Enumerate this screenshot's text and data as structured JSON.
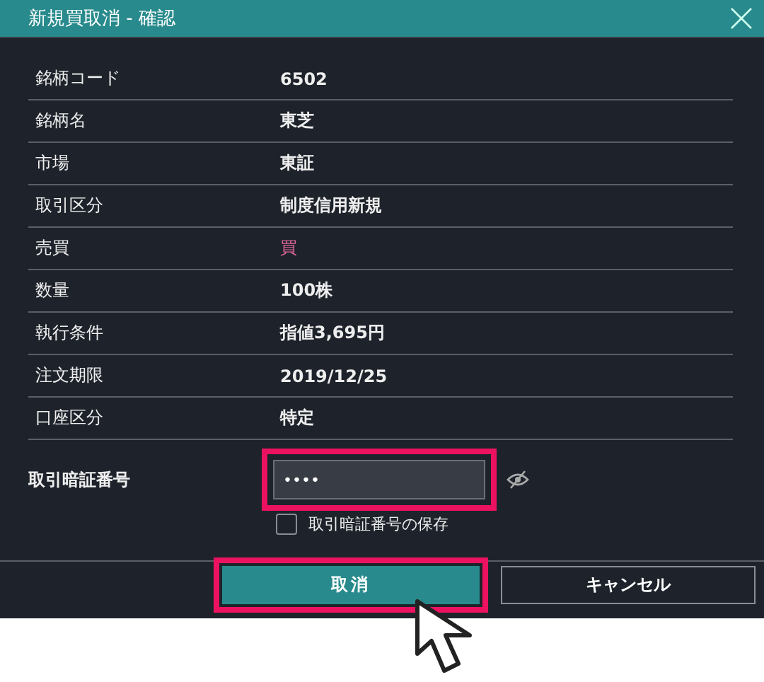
{
  "window": {
    "title": "新規買取消 - 確認"
  },
  "rows": [
    {
      "label": "銘柄コード",
      "value": "6502",
      "kind": "plain"
    },
    {
      "label": "銘柄名",
      "value": "東芝",
      "kind": "plain"
    },
    {
      "label": "市場",
      "value": "東証",
      "kind": "plain"
    },
    {
      "label": "取引区分",
      "value": "制度信用新規",
      "kind": "plain"
    },
    {
      "label": "売買",
      "value": "買",
      "kind": "buy"
    },
    {
      "label": "数量",
      "value": "100株",
      "kind": "plain"
    },
    {
      "label": "執行条件",
      "value": "指値3,695円",
      "kind": "plain"
    },
    {
      "label": "注文期限",
      "value": "2019/12/25",
      "kind": "plain"
    },
    {
      "label": "口座区分",
      "value": "特定",
      "kind": "plain"
    }
  ],
  "pin": {
    "label": "取引暗証番号",
    "value": "••••",
    "highlighted": true,
    "save_label": "取引暗証番号の保存",
    "save_checked": false
  },
  "buttons": [
    {
      "label": "取消",
      "kind": "primary",
      "highlighted": true
    },
    {
      "label": "キャンセル",
      "kind": "secondary",
      "highlighted": false
    }
  ]
}
